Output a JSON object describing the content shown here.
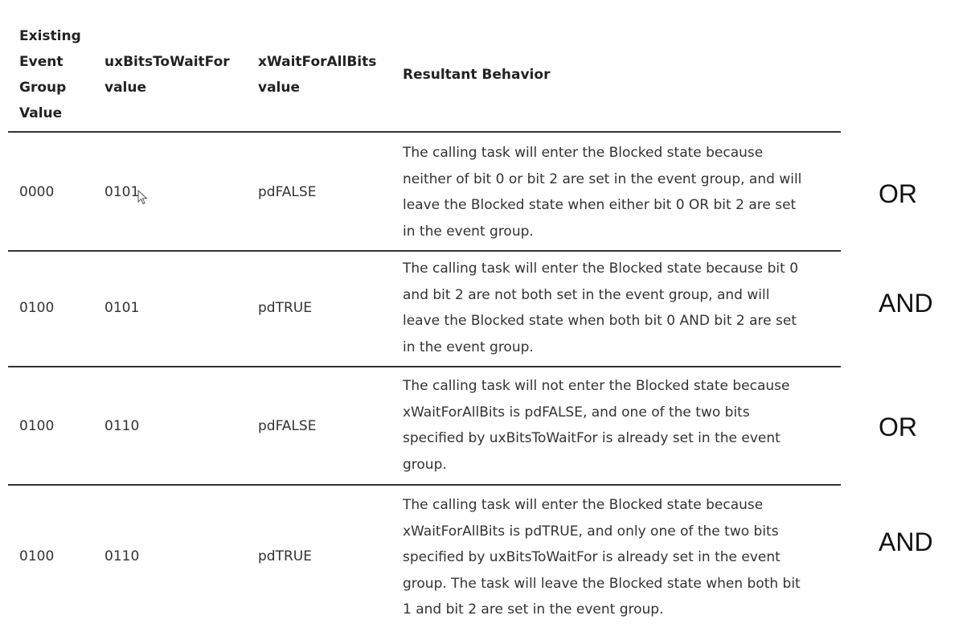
{
  "table": {
    "headers": [
      {
        "label": "Existing Event Group Value",
        "lines": [
          "Existing",
          "Event",
          "Group",
          "Value"
        ]
      },
      {
        "label": "uxBitsToWaitFor value",
        "lines": [
          "uxBitsToWaitFor",
          "value"
        ]
      },
      {
        "label": "xWaitForAllBits value",
        "lines": [
          "xWaitForAllBits",
          "value"
        ]
      },
      {
        "label": "Resultant Behavior",
        "lines": [
          "Resultant Behavior"
        ]
      }
    ],
    "rows": [
      {
        "event_group_value": "0000",
        "bits_to_wait_for": "0101",
        "wait_for_all_bits": "pdFALSE",
        "behavior": "The calling task will enter the Blocked state because neither of bit 0 or bit 2 are set in the event group, and will leave the Blocked state when either bit 0 OR bit 2 are set in the event group.",
        "behavior_lines": [
          "The calling task will enter the Blocked state because",
          "neither of bit 0 or bit 2 are set in the event group, and will",
          "leave the Blocked state when either bit 0 OR bit 2 are set",
          "in the event group."
        ],
        "annotation": "OR"
      },
      {
        "event_group_value": "0100",
        "bits_to_wait_for": "0101",
        "wait_for_all_bits": "pdTRUE",
        "behavior": "The calling task will enter the Blocked state because bit 0 and bit 2 are not both set in the event group, and will leave the Blocked state when both bit 0 AND bit 2 are set in the event group.",
        "behavior_lines": [
          "The calling task will enter the Blocked state because bit 0",
          "and bit 2 are not both set in the event group, and will",
          "leave the Blocked state when both bit 0 AND bit 2 are set",
          "in the event group."
        ],
        "annotation": "AND"
      },
      {
        "event_group_value": "0100",
        "bits_to_wait_for": "0110",
        "wait_for_all_bits": "pdFALSE",
        "behavior": "The calling task will not enter the Blocked state because xWaitForAllBits is pdFALSE, and one of the two bits specified by uxBitsToWaitFor is already set in the event group.",
        "behavior_lines": [
          "The calling task will not enter the Blocked state because",
          "xWaitForAllBits is pdFALSE, and one of the two bits",
          "specified by uxBitsToWaitFor is already set in the event",
          "group."
        ],
        "annotation": "OR"
      },
      {
        "event_group_value": "0100",
        "bits_to_wait_for": "0110",
        "wait_for_all_bits": "pdTRUE",
        "behavior": "The calling task will enter the Blocked state because xWaitForAllBits is pdTRUE, and only one of the two bits specified by uxBitsToWaitFor is already set in the event group. The task will leave the Blocked state when both bit 1 and bit 2 are set in the event group.",
        "behavior_lines": [
          "The calling task will enter the Blocked state because",
          "xWaitForAllBits is pdTRUE, and only one of the two bits",
          "specified by uxBitsToWaitFor is already set in the event",
          "group. The task will leave the Blocked state when both bit",
          "1 and bit 2 are set in the event group."
        ],
        "annotation": "AND"
      }
    ]
  },
  "colors": {
    "text": "#333333",
    "rule": "#333333",
    "annotation": "#111111",
    "background": "#ffffff"
  },
  "icons": {
    "cursor": "mouse-pointer-icon"
  }
}
